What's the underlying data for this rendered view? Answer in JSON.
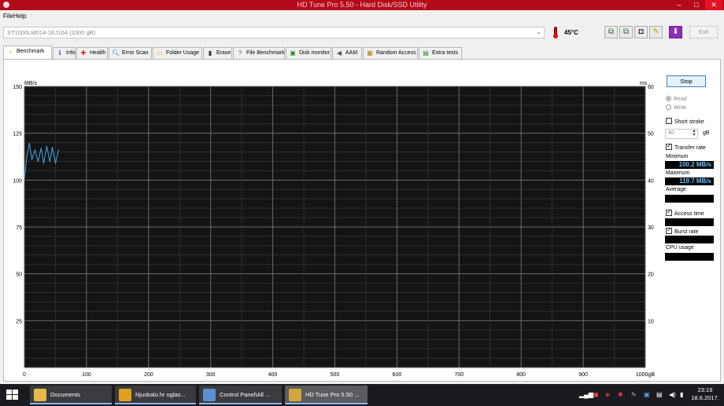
{
  "window": {
    "title": "HD Tune Pro 5.50 - Hard Disk/SSD Utility",
    "minimize": "–",
    "maximize": "□",
    "close": "✕"
  },
  "menu": {
    "file": "File",
    "help": "Help"
  },
  "device": {
    "drive": "ST1000LM014-1EJ164 (1000 gB)",
    "temperature": "45°C",
    "exit_label": "Exit"
  },
  "tabs": [
    {
      "label": "Benchmark",
      "icon": "benchmark-icon",
      "active": true
    },
    {
      "label": "Info",
      "icon": "info-icon"
    },
    {
      "label": "Health",
      "icon": "health-icon"
    },
    {
      "label": "Error Scan",
      "icon": "error-scan-icon"
    },
    {
      "label": "Folder Usage",
      "icon": "folder-icon"
    },
    {
      "label": "Erase",
      "icon": "erase-icon"
    },
    {
      "label": "File Benchmark",
      "icon": "file-benchmark-icon"
    },
    {
      "label": "Disk monitor",
      "icon": "disk-monitor-icon"
    },
    {
      "label": "AAM",
      "icon": "speaker-icon"
    },
    {
      "label": "Random Access",
      "icon": "random-access-icon"
    },
    {
      "label": "Extra tests",
      "icon": "extra-tests-icon"
    }
  ],
  "controls": {
    "stop": "Stop",
    "read": "Read",
    "write": "Write",
    "short_stroke": "Short stroke",
    "short_stroke_value": "40",
    "short_stroke_unit": "gB",
    "transfer_rate": "Transfer rate",
    "minimum_label": "Minimum",
    "minimum_value": "100.2 MB/s",
    "maximum_label": "Maximum",
    "maximum_value": "119.7 MB/s",
    "average_label": "Average",
    "average_value": "",
    "access_time": "Access time",
    "access_time_value": "",
    "burst_rate": "Burst rate",
    "burst_rate_value": "",
    "cpu_usage": "CPU usage",
    "cpu_usage_value": ""
  },
  "chart_data": {
    "type": "line",
    "y_label_left": "MB/s",
    "y_label_right": "ms",
    "x_unit": "gB",
    "ylim": [
      0,
      150
    ],
    "y2lim": [
      0,
      60
    ],
    "xlim": [
      0,
      1000
    ],
    "y_ticks": [
      "150",
      "125",
      "100",
      "75",
      "50",
      "25"
    ],
    "y2_ticks": [
      "60",
      "50",
      "40",
      "30",
      "20",
      "10"
    ],
    "x_ticks": [
      "0",
      "100",
      "200",
      "300",
      "400",
      "500",
      "600",
      "700",
      "800",
      "900",
      "1000gB"
    ],
    "grid": true,
    "background": "#141414",
    "line_color": "#3fa8e0",
    "series": [
      {
        "x": [
          0,
          4,
          8,
          12,
          17,
          22,
          27,
          31,
          36,
          41,
          45,
          50,
          55
        ],
        "values": [
          100.5,
          113,
          119.7,
          111,
          116,
          110,
          117,
          109,
          118,
          110,
          117.5,
          109,
          116
        ]
      }
    ]
  },
  "taskbar": {
    "items": [
      {
        "label": "Documents",
        "icon": "file-explorer-icon",
        "color": "#e8b84a"
      },
      {
        "label": "Njuskalo.hr oglas...",
        "icon": "chrome-icon",
        "color": "#e0a020"
      },
      {
        "label": "Control Panel\\All ...",
        "icon": "control-panel-icon",
        "color": "#5a8fd0"
      },
      {
        "label": "HD Tune Pro 5.50 ...",
        "icon": "hdtune-icon",
        "color": "#d4a640"
      }
    ],
    "time": "23:19",
    "date": "18.6.2017."
  }
}
